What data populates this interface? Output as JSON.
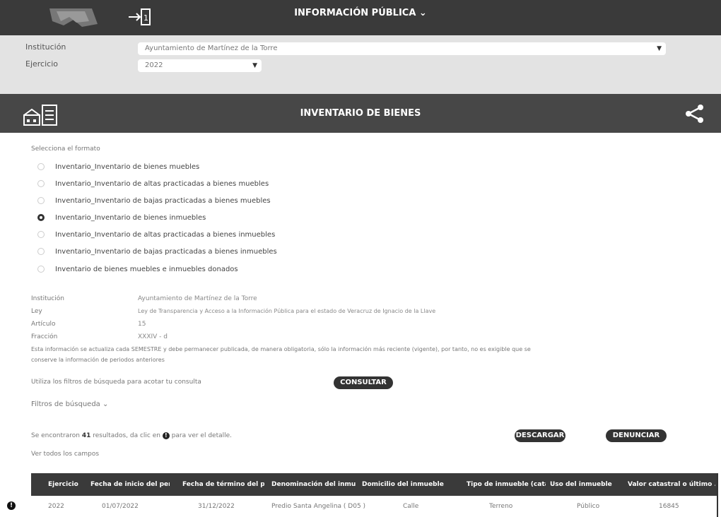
{
  "topbar": {
    "title": "INFORMACIÓN PÚBLICA ⌄"
  },
  "filters": {
    "institucion_label": "Institución",
    "institucion_value": "Ayuntamiento de Martínez de la Torre",
    "ejercicio_label": "Ejercicio",
    "ejercicio_value": "2022"
  },
  "section": {
    "title": "INVENTARIO DE BIENES"
  },
  "format": {
    "prompt": "Selecciona el formato",
    "options": [
      "Inventario_Inventario de bienes muebles",
      "Inventario_Inventario de altas practicadas a bienes muebles",
      "Inventario_Inventario de bajas practicadas a bienes muebles",
      "Inventario_Inventario de bienes inmuebles",
      "Inventario_Inventario de altas practicadas a bienes inmuebles",
      "Inventario_Inventario de bajas practicadas a bienes inmuebles",
      "Inventario de bienes muebles e inmuebles donados"
    ],
    "selected_index": 3
  },
  "meta": {
    "institucion_label": "Institución",
    "institucion_value": "Ayuntamiento de Martínez de la Torre",
    "ley_label": "Ley",
    "ley_value": "Ley de Transparencia y Acceso a la Información Pública para el estado de Veracruz de Ignacio de la Llave",
    "articulo_label": "Artículo",
    "articulo_value": "15",
    "fraccion_label": "Fracción",
    "fraccion_value": "XXXIV - d",
    "note_line1": "Esta información se actualiza cada SEMESTRE y debe permanecer publicada, de manera obligatoria, sólo la información más reciente (vigente), por tanto, no es exigible que se",
    "note_line2": "conserve la información de periodos anteriores"
  },
  "query": {
    "hint": "Utiliza los filtros de búsqueda para acotar tu consulta",
    "consultar": "CONSULTAR",
    "filters_toggle": "Filtros de búsqueda ⌄"
  },
  "results": {
    "prefix": "Se encontraron",
    "count": "41",
    "suffix_a": "resultados, da clic en",
    "suffix_b": "para ver el detalle.",
    "descargar": "DESCARGAR",
    "denunciar": "DENUNCIAR",
    "ver_todos": "Ver todos los campos"
  },
  "table": {
    "headers": [
      "Ejercicio",
      "Fecha de inicio del peri...",
      "Fecha de término del p...",
      "Denominación del inmu...",
      "Domicilio del inmueble:...",
      "Tipo de inmueble (catál...",
      "Uso del inmueble",
      "Valor catastral o último ..."
    ],
    "rows": [
      [
        "2022",
        "01/07/2022",
        "31/12/2022",
        "Predio Santa Angelina ( D05 )",
        "Calle",
        "Terreno",
        "Público",
        "16845"
      ]
    ]
  },
  "icons": {
    "login": "login-icon",
    "section": "building-document-icon",
    "share": "share-icon",
    "info": "info-icon"
  }
}
